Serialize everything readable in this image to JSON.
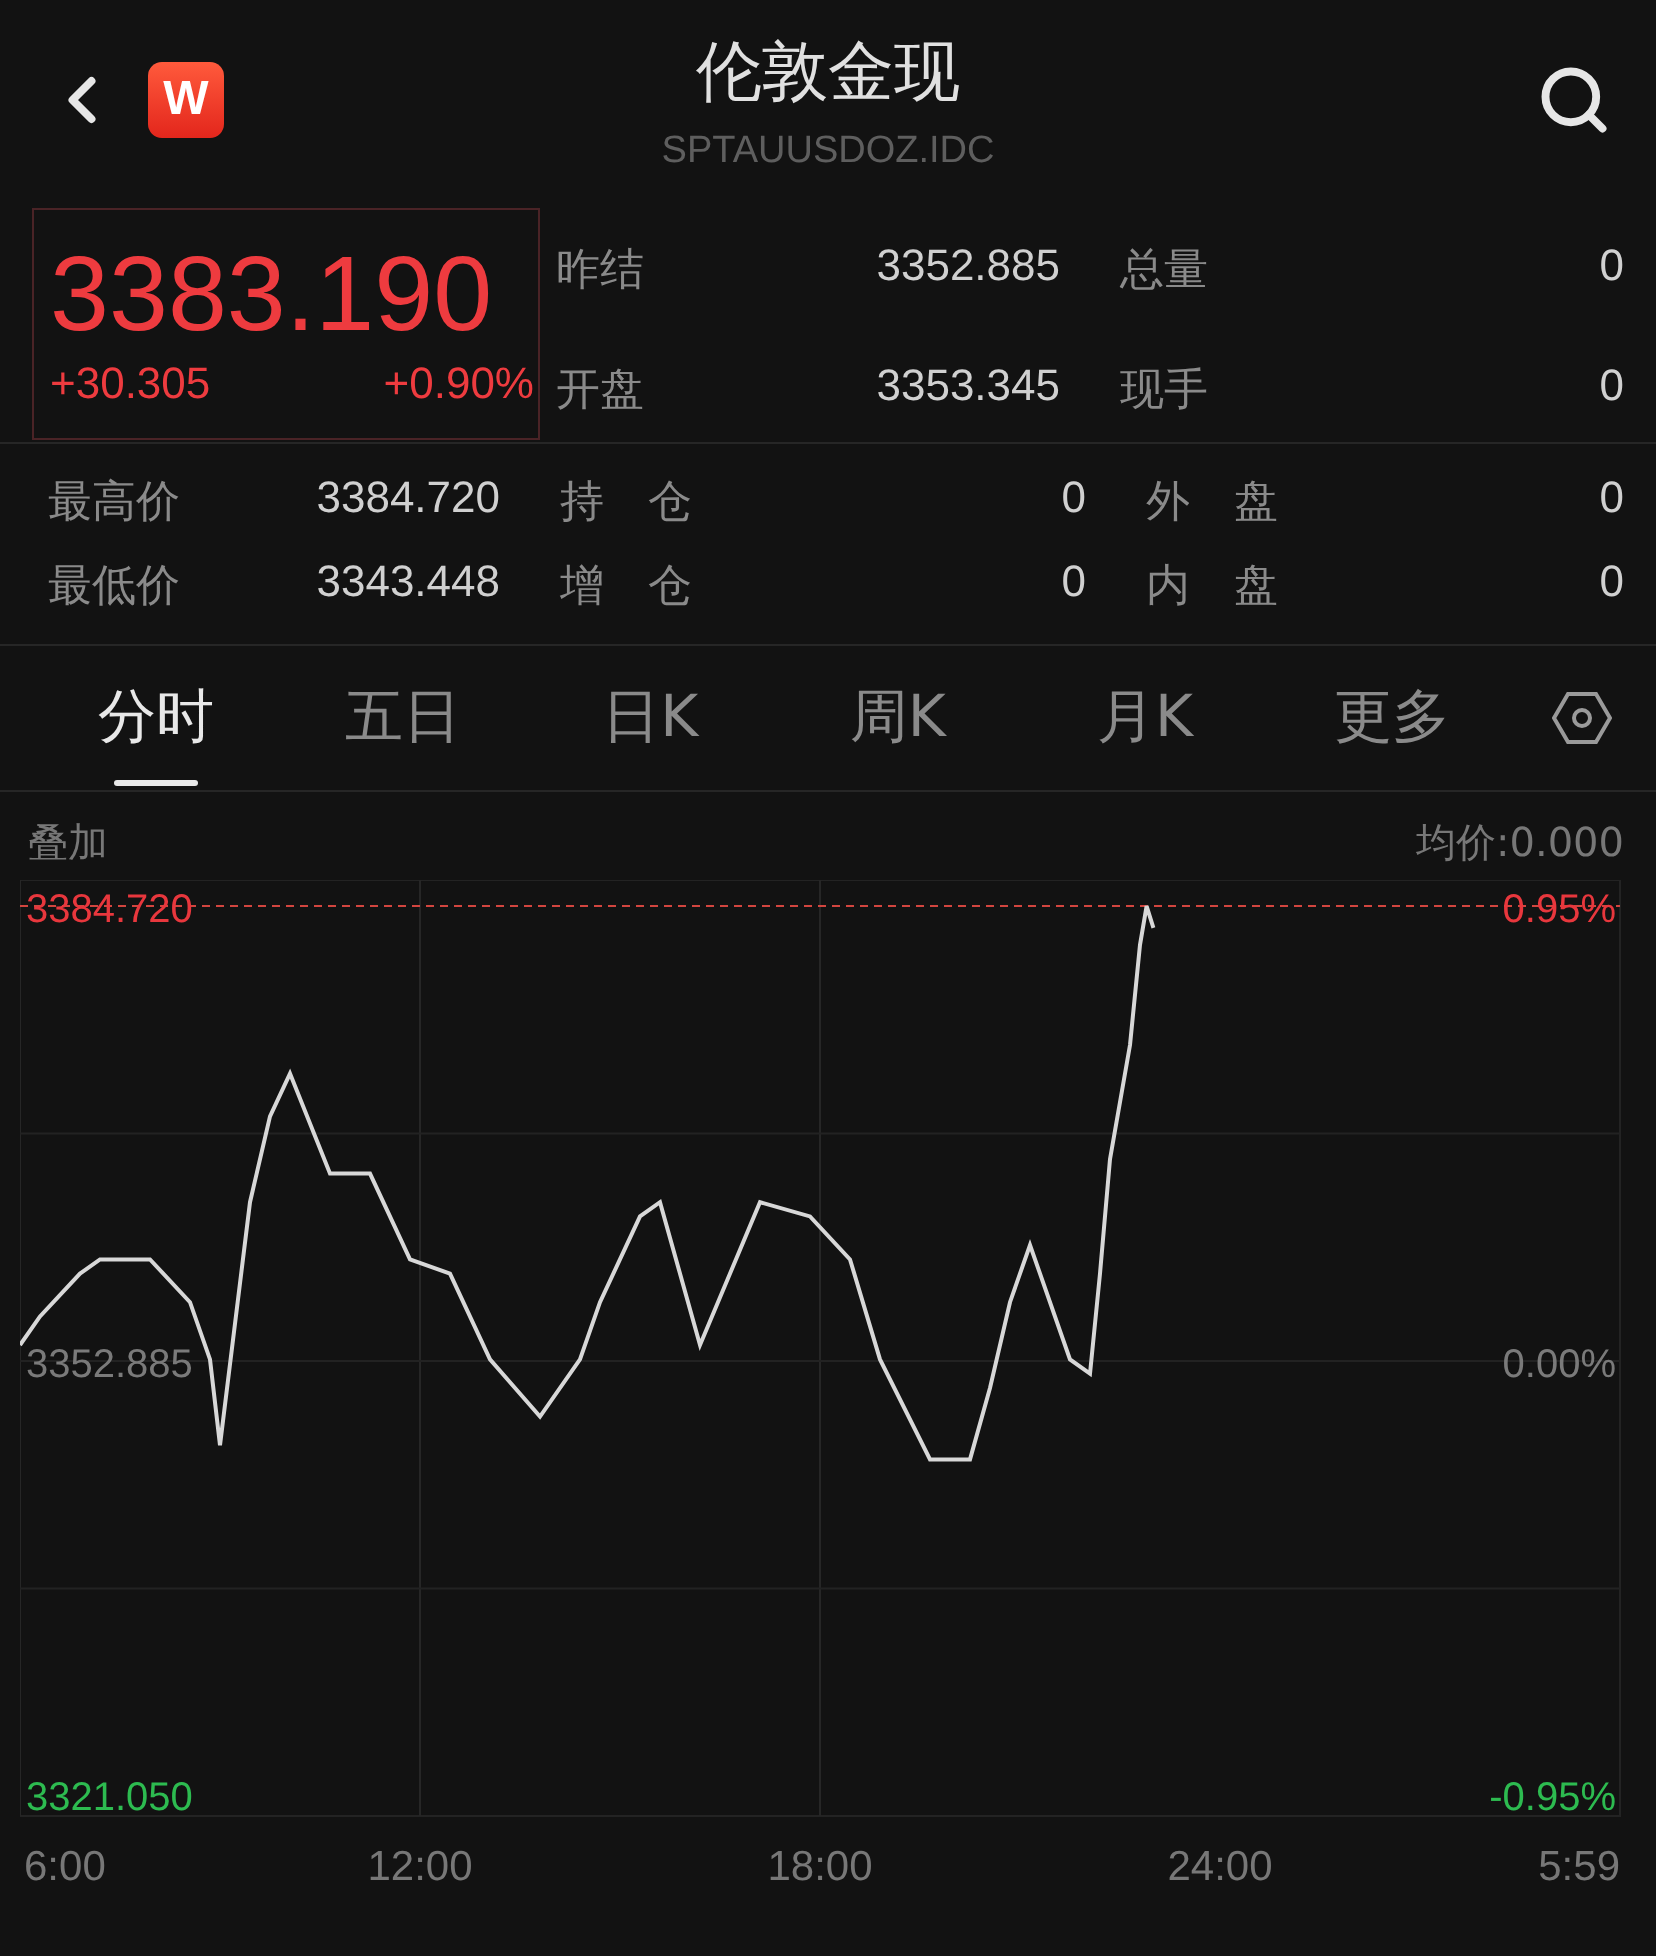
{
  "header": {
    "logo": {
      "text": "W"
    },
    "title": "伦敦金现",
    "code": "SPTAUUSDOZ.IDC"
  },
  "quote": {
    "price": "3383.190",
    "change": "+30.305",
    "change_pct": "+0.90%",
    "stats": [
      {
        "label": "昨结",
        "value": "3352.885"
      },
      {
        "label": "总量",
        "value": "0"
      },
      {
        "label": "开盘",
        "value": "3353.345"
      },
      {
        "label": "现手",
        "value": "0"
      }
    ]
  },
  "details": [
    [
      {
        "label": "最高价",
        "value": "3384.720"
      },
      {
        "label": "持　仓",
        "value": "0"
      },
      {
        "label": "外　盘",
        "value": "0"
      }
    ],
    [
      {
        "label": "最低价",
        "value": "3343.448"
      },
      {
        "label": "增　仓",
        "value": "0"
      },
      {
        "label": "内　盘",
        "value": "0"
      }
    ]
  ],
  "tabs": [
    {
      "label": "分时",
      "selected": true
    },
    {
      "label": "五日",
      "selected": false
    },
    {
      "label": "日K",
      "selected": false
    },
    {
      "label": "周K",
      "selected": false
    },
    {
      "label": "月K",
      "selected": false
    },
    {
      "label": "更多",
      "selected": false
    }
  ],
  "chart_bar": {
    "overlay": "叠加",
    "average": "均价:0.000"
  },
  "chart": {
    "end_time": "5:59",
    "right_labels": [
      "0.95%",
      "0.00%",
      "-0.95%"
    ],
    "chart_data": {
      "type": "line",
      "xlim": [
        6,
        30
      ],
      "ylim": [
        3321.05,
        3384.72
      ],
      "xticks": [
        {
          "value": 6,
          "label": "6:00"
        },
        {
          "value": 12,
          "label": "12:00"
        },
        {
          "value": 18,
          "label": "18:00"
        },
        {
          "value": 24,
          "label": "24:00"
        }
      ],
      "yticks": [
        {
          "value": 3384.72,
          "label": "3384.720"
        },
        {
          "value": 3352.885,
          "label": "3352.885"
        },
        {
          "value": 3321.05,
          "label": "3321.050"
        }
      ],
      "x": [
        6,
        6.3,
        6.9,
        7.2,
        7.95,
        8.55,
        8.85,
        9.0,
        9.45,
        9.75,
        10.05,
        10.65,
        11.25,
        11.85,
        12.45,
        13.05,
        13.8,
        14.4,
        14.7,
        15.3,
        15.6,
        16.2,
        17.1,
        17.85,
        18.45,
        18.9,
        19.65,
        20.25,
        20.55,
        20.85,
        21.15,
        21.75,
        22.05,
        22.2,
        22.35,
        22.65,
        22.8,
        22.9,
        23.0
      ],
      "series": [
        {
          "color": "#d8d8d8",
          "values": [
            3354,
            3356,
            3359,
            3360,
            3360,
            3357,
            3353,
            3347,
            3364,
            3370,
            3373,
            3366,
            3366,
            3360,
            3359,
            3353,
            3349,
            3353,
            3357,
            3363,
            3364,
            3354,
            3364,
            3363,
            3360,
            3353,
            3346,
            3346,
            3351,
            3357,
            3361,
            3353,
            3352,
            3359,
            3367,
            3375,
            3382,
            3384.7,
            3383.2
          ]
        }
      ]
    }
  }
}
